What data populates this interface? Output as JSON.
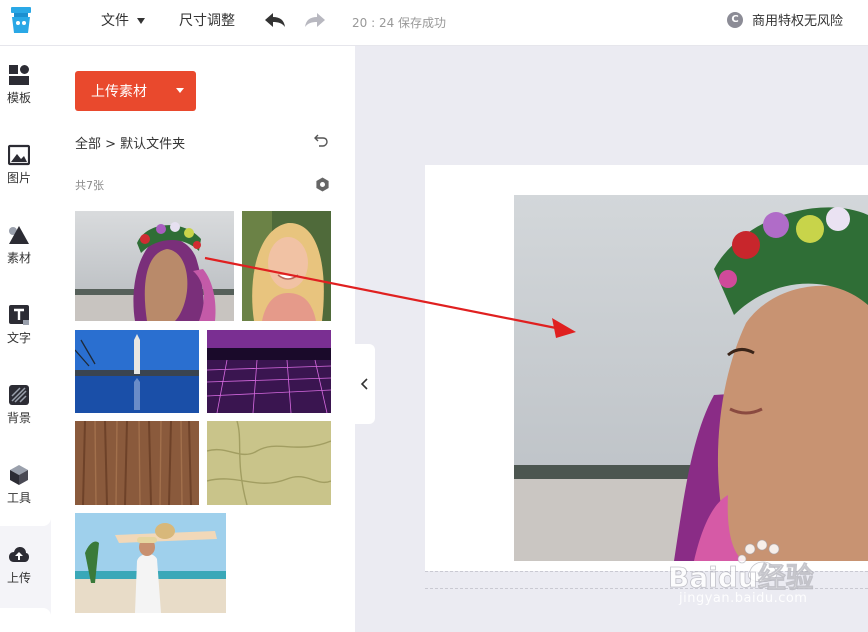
{
  "topbar": {
    "file_menu": "文件",
    "resize_menu": "尺寸调整",
    "save_status": "20 : 24 保存成功",
    "commercial_label": "商用特权无风险",
    "commercial_badge": "C"
  },
  "sidebar": {
    "items": [
      {
        "label": "模板",
        "icon": "template-icon"
      },
      {
        "label": "图片",
        "icon": "image-icon"
      },
      {
        "label": "素材",
        "icon": "shapes-icon"
      },
      {
        "label": "文字",
        "icon": "text-icon"
      },
      {
        "label": "背景",
        "icon": "background-icon"
      },
      {
        "label": "工具",
        "icon": "cube-icon"
      },
      {
        "label": "上传",
        "icon": "cloud-upload-icon"
      }
    ]
  },
  "panel": {
    "upload_button": "上传素材",
    "breadcrumb": "全部 > 默认文件夹",
    "count": "共7张"
  },
  "watermark": {
    "brand": "Baidu经验",
    "url": "jingyan.baidu.com"
  },
  "colors": {
    "accent": "#e9492d",
    "arrow": "#e02020",
    "canvas_bg": "#ebebf2"
  }
}
